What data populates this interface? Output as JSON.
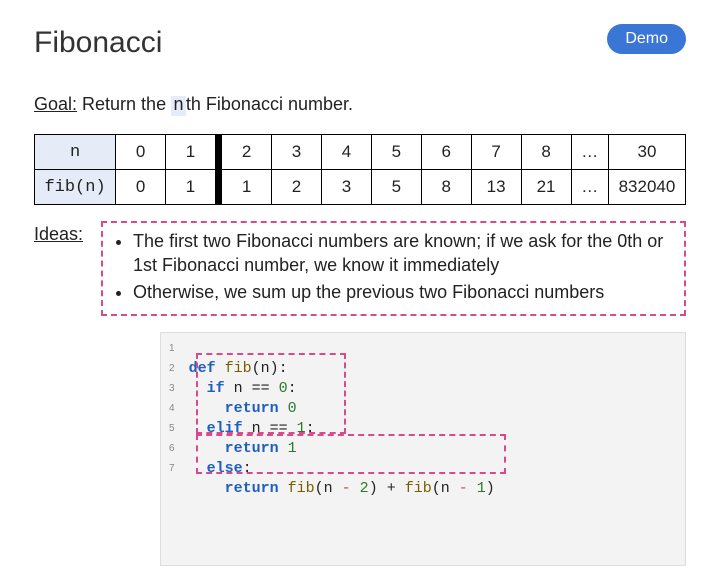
{
  "demo_label": "Demo",
  "title": "Fibonacci",
  "goal_label": "Goal:",
  "goal_prefix": " Return the ",
  "goal_n": "n",
  "goal_suffix": "th Fibonacci number.",
  "table": {
    "row_n_label": "n",
    "row_fib_label": "fib(n)",
    "cols": [
      "0",
      "1",
      "2",
      "3",
      "4",
      "5",
      "6",
      "7",
      "8",
      "…",
      "30"
    ],
    "vals": [
      "0",
      "1",
      "1",
      "2",
      "3",
      "5",
      "8",
      "13",
      "21",
      "…",
      "832040"
    ]
  },
  "ideas_label": "Ideas:",
  "ideas": [
    "The first two Fibonacci numbers are known; if we ask for the 0th or 1st Fibonacci number, we know it immediately",
    "Otherwise, we sum up the previous two Fibonacci numbers"
  ],
  "code": {
    "lines": [
      "1",
      "2",
      "3",
      "4",
      "5",
      "6",
      "7"
    ],
    "l1_def": "def",
    "l1_fn": "fib",
    "l1_rest": "(n):",
    "l2_if": "if",
    "l2_cond": " n == ",
    "l2_zero": "0",
    "l3_ret": "return",
    "l3_val": "0",
    "l4_elif": "elif",
    "l4_cond": " n == ",
    "l4_one": "1",
    "l5_ret": "return",
    "l5_val": "1",
    "l6_else": "else",
    "l7_ret": "return",
    "l7_fn1": "fib",
    "l7_m2a": "(n ",
    "l7_minus1": "-",
    "l7_m2b": " ",
    "l7_two": "2",
    "l7_cp1": ")",
    "l7_plus": " + ",
    "l7_fn2": "fib",
    "l7_m1a": "(n ",
    "l7_minus2": "-",
    "l7_m1b": " ",
    "l7_one": "1",
    "l7_cp2": ")"
  },
  "chart_data": {
    "type": "table",
    "title": "Fibonacci sequence",
    "columns": [
      "n",
      "fib(n)"
    ],
    "rows": [
      [
        0,
        0
      ],
      [
        1,
        1
      ],
      [
        2,
        1
      ],
      [
        3,
        2
      ],
      [
        4,
        3
      ],
      [
        5,
        5
      ],
      [
        6,
        8
      ],
      [
        7,
        13
      ],
      [
        8,
        21
      ],
      [
        30,
        832040
      ]
    ]
  }
}
